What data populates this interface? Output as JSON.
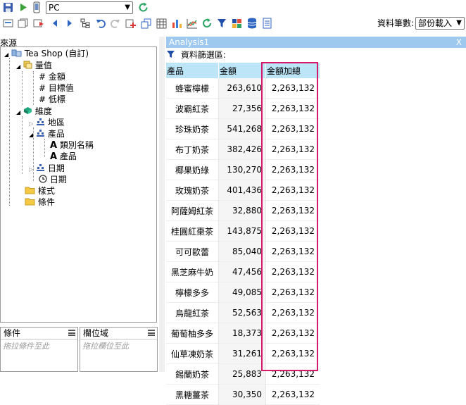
{
  "toolbar_top": {
    "connection_value": "PC"
  },
  "toolbar_second": {
    "row_count_label": "資料筆數:",
    "row_count_value": "部份載入"
  },
  "left_panel": {
    "title": "來源",
    "tree": [
      {
        "label": "Tea Shop (自訂)",
        "icon": "database-icon"
      },
      {
        "label": "量值",
        "icon": "measure-folder-icon"
      },
      {
        "label": "金額",
        "icon": "hash-icon"
      },
      {
        "label": "目標值",
        "icon": "hash-icon"
      },
      {
        "label": "低標",
        "icon": "hash-icon"
      },
      {
        "label": "維度",
        "icon": "dimension-icon"
      },
      {
        "label": "地區",
        "icon": "hierarchy-icon"
      },
      {
        "label": "產品",
        "icon": "hierarchy-icon"
      },
      {
        "label": "類別名稱",
        "icon": "text-attribute-icon"
      },
      {
        "label": "產品",
        "icon": "text-attribute-icon"
      },
      {
        "label": "日期",
        "icon": "hierarchy-icon"
      },
      {
        "label": "日期",
        "icon": "clock-icon"
      },
      {
        "label": "樣式",
        "icon": "folder-icon"
      },
      {
        "label": "條件",
        "icon": "folder-icon"
      }
    ]
  },
  "bottom_boxes": {
    "conditions_title": "條件",
    "conditions_placeholder": "拖拉條件至此",
    "columns_title": "欄位域",
    "columns_placeholder": "拖拉欄位至此"
  },
  "analysis": {
    "title": "Analysis1",
    "close_label": "X",
    "filter_label": "資料篩選區:",
    "columns": [
      "產品",
      "金額",
      "金額加總"
    ],
    "rows": [
      [
        "蜂蜜檸檬",
        "263,610",
        "2,263,132"
      ],
      [
        "波霸紅茶",
        "27,356",
        "2,263,132"
      ],
      [
        "珍珠奶茶",
        "541,268",
        "2,263,132"
      ],
      [
        "布丁奶茶",
        "382,426",
        "2,263,132"
      ],
      [
        "椰果奶綠",
        "130,270",
        "2,263,132"
      ],
      [
        "玫瑰奶茶",
        "401,436",
        "2,263,132"
      ],
      [
        "阿薩姆紅茶",
        "32,880",
        "2,263,132"
      ],
      [
        "桂圓紅棗茶",
        "143,875",
        "2,263,132"
      ],
      [
        "可可歐蕾",
        "85,040",
        "2,263,132"
      ],
      [
        "黑芝麻牛奶",
        "47,456",
        "2,263,132"
      ],
      [
        "檸檬多多",
        "49,085",
        "2,263,132"
      ],
      [
        "烏龍紅茶",
        "52,563",
        "2,263,132"
      ],
      [
        "葡萄柚多多",
        "18,373",
        "2,263,132"
      ],
      [
        "仙草凍奶茶",
        "31,261",
        "2,263,132"
      ],
      [
        "錫蘭奶茶",
        "25,883",
        "2,263,132"
      ],
      [
        "黑糖薑茶",
        "30,350",
        "2,263,132"
      ]
    ]
  },
  "colors": {
    "header_bar": "#9dc9ef",
    "column_header": "#bde5f8",
    "highlight": "#d6196b"
  }
}
